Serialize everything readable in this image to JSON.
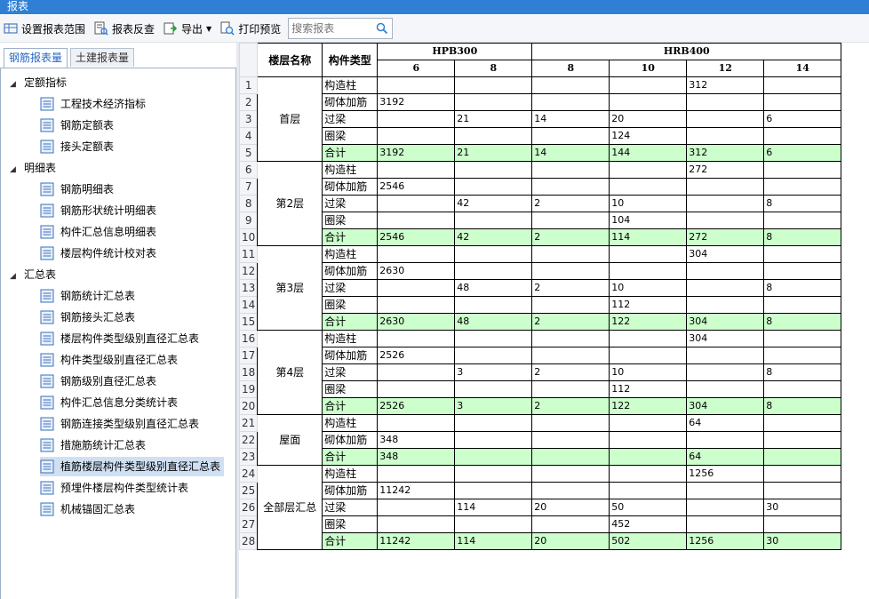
{
  "window": {
    "title": "报表"
  },
  "toolbar": {
    "set_range": "设置报表范围",
    "reverse_check": "报表反查",
    "export": "导出",
    "print_preview": "打印预览",
    "search_placeholder": "搜索报表"
  },
  "tabs": [
    {
      "label": "钢筋报表量",
      "active": true
    },
    {
      "label": "土建报表量",
      "active": false
    }
  ],
  "tree": [
    {
      "label": "定额指标",
      "items": [
        "工程技术经济指标",
        "钢筋定额表",
        "接头定额表"
      ]
    },
    {
      "label": "明细表",
      "items": [
        "钢筋明细表",
        "钢筋形状统计明细表",
        "构件汇总信息明细表",
        "楼层构件统计校对表"
      ]
    },
    {
      "label": "汇总表",
      "items": [
        "钢筋统计汇总表",
        "钢筋接头汇总表",
        "楼层构件类型级别直径汇总表",
        "构件类型级别直径汇总表",
        "钢筋级别直径汇总表",
        "构件汇总信息分类统计表",
        "钢筋连接类型级别直径汇总表",
        "措施筋统计汇总表",
        "植筋楼层构件类型级别直径汇总表",
        "预埋件楼层构件类型统计表",
        "机械锚固汇总表"
      ]
    }
  ],
  "selected_item": "植筋楼层构件类型级别直径汇总表",
  "colors": {
    "titlebar": "#2f7fd4",
    "total_row": "#ccffcc",
    "selection": "#cfe0f3"
  },
  "report": {
    "headers": {
      "floor": "楼层名称",
      "type": "构件类型",
      "groups": [
        {
          "name": "HPB300",
          "diameters": [
            "6",
            "8"
          ]
        },
        {
          "name": "HRB400",
          "diameters": [
            "8",
            "10",
            "12",
            "14"
          ]
        }
      ]
    },
    "rows": [
      {
        "n": "1",
        "floor": "首层",
        "type": "构造柱",
        "vals": [
          "",
          "",
          "",
          "",
          "312",
          ""
        ]
      },
      {
        "n": "2",
        "floor": "首层",
        "type": "砌体加筋",
        "vals": [
          "3192",
          "",
          "",
          "",
          "",
          ""
        ]
      },
      {
        "n": "3",
        "floor": "首层",
        "type": "过梁",
        "vals": [
          "",
          "21",
          "14",
          "20",
          "",
          "6"
        ]
      },
      {
        "n": "4",
        "floor": "首层",
        "type": "圈梁",
        "vals": [
          "",
          "",
          "",
          "124",
          "",
          ""
        ]
      },
      {
        "n": "5",
        "floor": "首层",
        "type": "合计",
        "vals": [
          "3192",
          "21",
          "14",
          "144",
          "312",
          "6"
        ],
        "total": true
      },
      {
        "n": "6",
        "floor": "第2层",
        "type": "构造柱",
        "vals": [
          "",
          "",
          "",
          "",
          "272",
          ""
        ]
      },
      {
        "n": "7",
        "floor": "第2层",
        "type": "砌体加筋",
        "vals": [
          "2546",
          "",
          "",
          "",
          "",
          ""
        ]
      },
      {
        "n": "8",
        "floor": "第2层",
        "type": "过梁",
        "vals": [
          "",
          "42",
          "2",
          "10",
          "",
          "8"
        ]
      },
      {
        "n": "9",
        "floor": "第2层",
        "type": "圈梁",
        "vals": [
          "",
          "",
          "",
          "104",
          "",
          ""
        ]
      },
      {
        "n": "10",
        "floor": "第2层",
        "type": "合计",
        "vals": [
          "2546",
          "42",
          "2",
          "114",
          "272",
          "8"
        ],
        "total": true
      },
      {
        "n": "11",
        "floor": "第3层",
        "type": "构造柱",
        "vals": [
          "",
          "",
          "",
          "",
          "304",
          ""
        ]
      },
      {
        "n": "12",
        "floor": "第3层",
        "type": "砌体加筋",
        "vals": [
          "2630",
          "",
          "",
          "",
          "",
          ""
        ]
      },
      {
        "n": "13",
        "floor": "第3层",
        "type": "过梁",
        "vals": [
          "",
          "48",
          "2",
          "10",
          "",
          "8"
        ]
      },
      {
        "n": "14",
        "floor": "第3层",
        "type": "圈梁",
        "vals": [
          "",
          "",
          "",
          "112",
          "",
          ""
        ]
      },
      {
        "n": "15",
        "floor": "第3层",
        "type": "合计",
        "vals": [
          "2630",
          "48",
          "2",
          "122",
          "304",
          "8"
        ],
        "total": true
      },
      {
        "n": "16",
        "floor": "第4层",
        "type": "构造柱",
        "vals": [
          "",
          "",
          "",
          "",
          "304",
          ""
        ]
      },
      {
        "n": "17",
        "floor": "第4层",
        "type": "砌体加筋",
        "vals": [
          "2526",
          "",
          "",
          "",
          "",
          ""
        ]
      },
      {
        "n": "18",
        "floor": "第4层",
        "type": "过梁",
        "vals": [
          "",
          "3",
          "2",
          "10",
          "",
          "8"
        ]
      },
      {
        "n": "19",
        "floor": "第4层",
        "type": "圈梁",
        "vals": [
          "",
          "",
          "",
          "112",
          "",
          ""
        ]
      },
      {
        "n": "20",
        "floor": "第4层",
        "type": "合计",
        "vals": [
          "2526",
          "3",
          "2",
          "122",
          "304",
          "8"
        ],
        "total": true
      },
      {
        "n": "21",
        "floor": "屋面",
        "type": "构造柱",
        "vals": [
          "",
          "",
          "",
          "",
          "64",
          ""
        ]
      },
      {
        "n": "22",
        "floor": "屋面",
        "type": "砌体加筋",
        "vals": [
          "348",
          "",
          "",
          "",
          "",
          ""
        ]
      },
      {
        "n": "23",
        "floor": "屋面",
        "type": "合计",
        "vals": [
          "348",
          "",
          "",
          "",
          "64",
          ""
        ],
        "total": true
      },
      {
        "n": "24",
        "floor": "全部层汇总",
        "type": "构造柱",
        "vals": [
          "",
          "",
          "",
          "",
          "1256",
          ""
        ]
      },
      {
        "n": "25",
        "floor": "全部层汇总",
        "type": "砌体加筋",
        "vals": [
          "11242",
          "",
          "",
          "",
          "",
          ""
        ]
      },
      {
        "n": "26",
        "floor": "全部层汇总",
        "type": "过梁",
        "vals": [
          "",
          "114",
          "20",
          "50",
          "",
          "30"
        ]
      },
      {
        "n": "27",
        "floor": "全部层汇总",
        "type": "圈梁",
        "vals": [
          "",
          "",
          "",
          "452",
          "",
          ""
        ]
      },
      {
        "n": "28",
        "floor": "全部层汇总",
        "type": "合计",
        "vals": [
          "11242",
          "114",
          "20",
          "502",
          "1256",
          "30"
        ],
        "total": true
      }
    ]
  }
}
